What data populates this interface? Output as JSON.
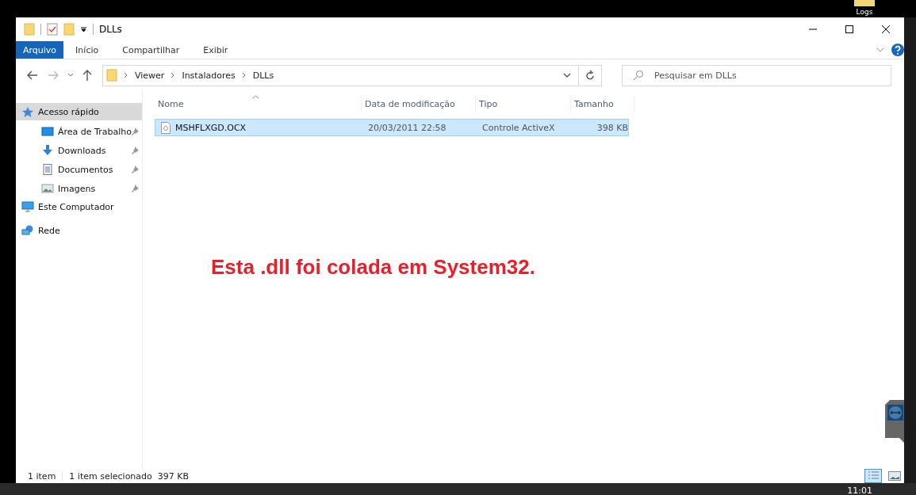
{
  "desktop": {
    "icon_label": "Logs"
  },
  "window": {
    "title": "DLLs"
  },
  "ribbon": {
    "tabs": [
      {
        "label": "Arquivo",
        "selected": true
      },
      {
        "label": "Início",
        "selected": false
      },
      {
        "label": "Compartilhar",
        "selected": false
      },
      {
        "label": "Exibir",
        "selected": false
      }
    ]
  },
  "address_bar": {
    "path": [
      "Viewer",
      "Instaladores",
      "DLLs"
    ]
  },
  "search": {
    "placeholder": "Pesquisar em DLLs"
  },
  "sidebar": {
    "items": [
      {
        "label": "Acesso rápido",
        "kind": "star",
        "selected": true,
        "pinned": false,
        "children": [
          {
            "label": "Área de Trabalho",
            "kind": "desktop",
            "selected": false,
            "pinned": true
          },
          {
            "label": "Downloads",
            "kind": "download",
            "selected": false,
            "pinned": true
          },
          {
            "label": "Documentos",
            "kind": "document",
            "selected": false,
            "pinned": true
          },
          {
            "label": "Imagens",
            "kind": "image",
            "selected": false,
            "pinned": true
          }
        ]
      },
      {
        "label": "Este Computador",
        "kind": "computer",
        "selected": false,
        "pinned": false
      },
      {
        "label": "Rede",
        "kind": "network",
        "selected": false,
        "pinned": false
      }
    ]
  },
  "table": {
    "columns": [
      "Nome",
      "Data de modificação",
      "Tipo",
      "Tamanho"
    ],
    "rows": [
      {
        "cells": [
          "MSHFLXGD.OCX",
          "20/03/2011 22:58",
          "Controle ActiveX",
          "398 KB"
        ],
        "selected": true
      }
    ]
  },
  "annotation": "Esta .dll foi colada em System32.",
  "status_bar": {
    "count": "1 item",
    "selection": "1 item selecionado  397 KB"
  },
  "taskbar": {
    "time": "11:01"
  }
}
